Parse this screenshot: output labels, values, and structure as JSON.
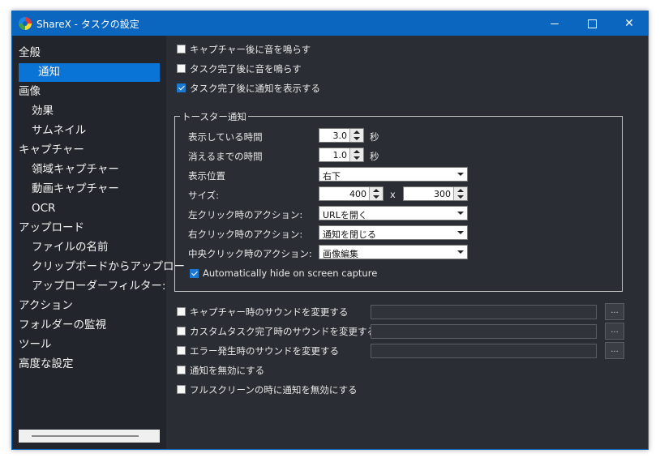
{
  "window": {
    "title": "ShareX - タスクの設定"
  },
  "sidebar": {
    "items": [
      {
        "label": "全般"
      },
      {
        "label": "通知"
      },
      {
        "label": "画像"
      },
      {
        "label": "効果"
      },
      {
        "label": "サムネイル"
      },
      {
        "label": "キャプチャー"
      },
      {
        "label": "領域キャプチャー"
      },
      {
        "label": "動画キャプチャー"
      },
      {
        "label": "OCR"
      },
      {
        "label": "アップロード"
      },
      {
        "label": "ファイルの名前"
      },
      {
        "label": "クリップボードからアップロー"
      },
      {
        "label": "アップローダーフィルター:"
      },
      {
        "label": "アクション"
      },
      {
        "label": "フォルダーの監視"
      },
      {
        "label": "ツール"
      },
      {
        "label": "高度な設定"
      }
    ]
  },
  "top_options": {
    "play_sound_after_capture": "キャプチャー後に音を鳴らす",
    "play_sound_after_task": "タスク完了後に音を鳴らす",
    "show_notification_after_task": "タスク完了後に通知を表示する"
  },
  "toast": {
    "group_title": "トースター通知",
    "duration_label": "表示している時間",
    "duration_value": "3.0",
    "fade_label": "消えるまでの時間",
    "fade_value": "1.0",
    "seconds_unit": "秒",
    "position_label": "表示位置",
    "position_value": "右下",
    "size_label": "サイズ:",
    "size_width": "400",
    "size_height": "300",
    "size_x": "x",
    "left_click_label": "左クリック時のアクション:",
    "left_click_value": "URLを開く",
    "right_click_label": "右クリック時のアクション:",
    "right_click_value": "通知を閉じる",
    "middle_click_label": "中央クリック時のアクション:",
    "middle_click_value": "画像編集",
    "auto_hide_label": "Automatically hide on screen capture"
  },
  "bottom_options": {
    "capture_sound": "キャプチャー時のサウンドを変更する",
    "task_sound": "カスタムタスク完了時のサウンドを変更する",
    "error_sound": "エラー発生時のサウンドを変更する",
    "disable_notifications": "通知を無効にする",
    "disable_fullscreen": "フルスクリーンの時に通知を無効にする",
    "browse_label": "..."
  }
}
